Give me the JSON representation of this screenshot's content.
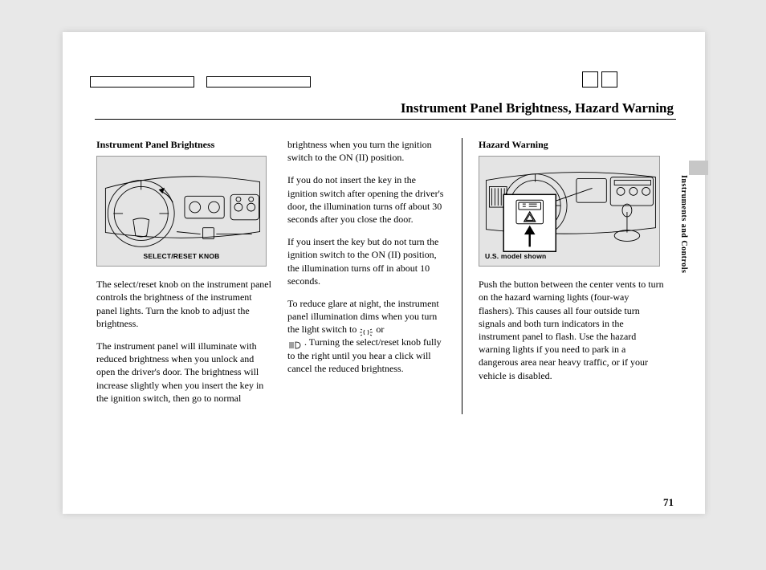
{
  "pageTitle": "Instrument Panel Brightness, Hazard Warning",
  "sideLabel": "Instruments and Controls",
  "pageNumber": "71",
  "col1": {
    "heading": "Instrument Panel Brightness",
    "caption": "SELECT/RESET KNOB",
    "para1": "The select/reset knob on the instrument panel controls the brightness of the instrument panel lights. Turn the knob to adjust the brightness.",
    "para2": "The instrument panel will illuminate with reduced brightness when you unlock and open the driver's door. The brightness will increase slightly when you insert the key in the ignition switch, then go to normal"
  },
  "col2": {
    "para1": "brightness when you turn the ignition switch to the ON (II) position.",
    "para2": "If you do not insert the key in the ignition switch after opening the driver's door, the illumination turns off about 30 seconds after you close the door.",
    "para3": "If you insert the key but do not turn the ignition switch to the ON (II) position, the illumination turns off in about 10 seconds.",
    "para4a": "To reduce glare at night, the instrument panel illumination dims when you turn the light switch to ",
    "para4b": " or ",
    "para4c": " . Turning the select/reset knob fully to the right until you hear a click will cancel the reduced brightness."
  },
  "col3": {
    "heading": "Hazard Warning",
    "caption": "U.S. model shown",
    "para1": "Push the button between the center vents to turn on the hazard warning lights (four-way flashers). This causes all four outside turn signals and both turn indicators in the instrument panel to flash. Use the hazard warning lights if you need to park in a dangerous area near heavy traffic, or if your vehicle is disabled."
  }
}
